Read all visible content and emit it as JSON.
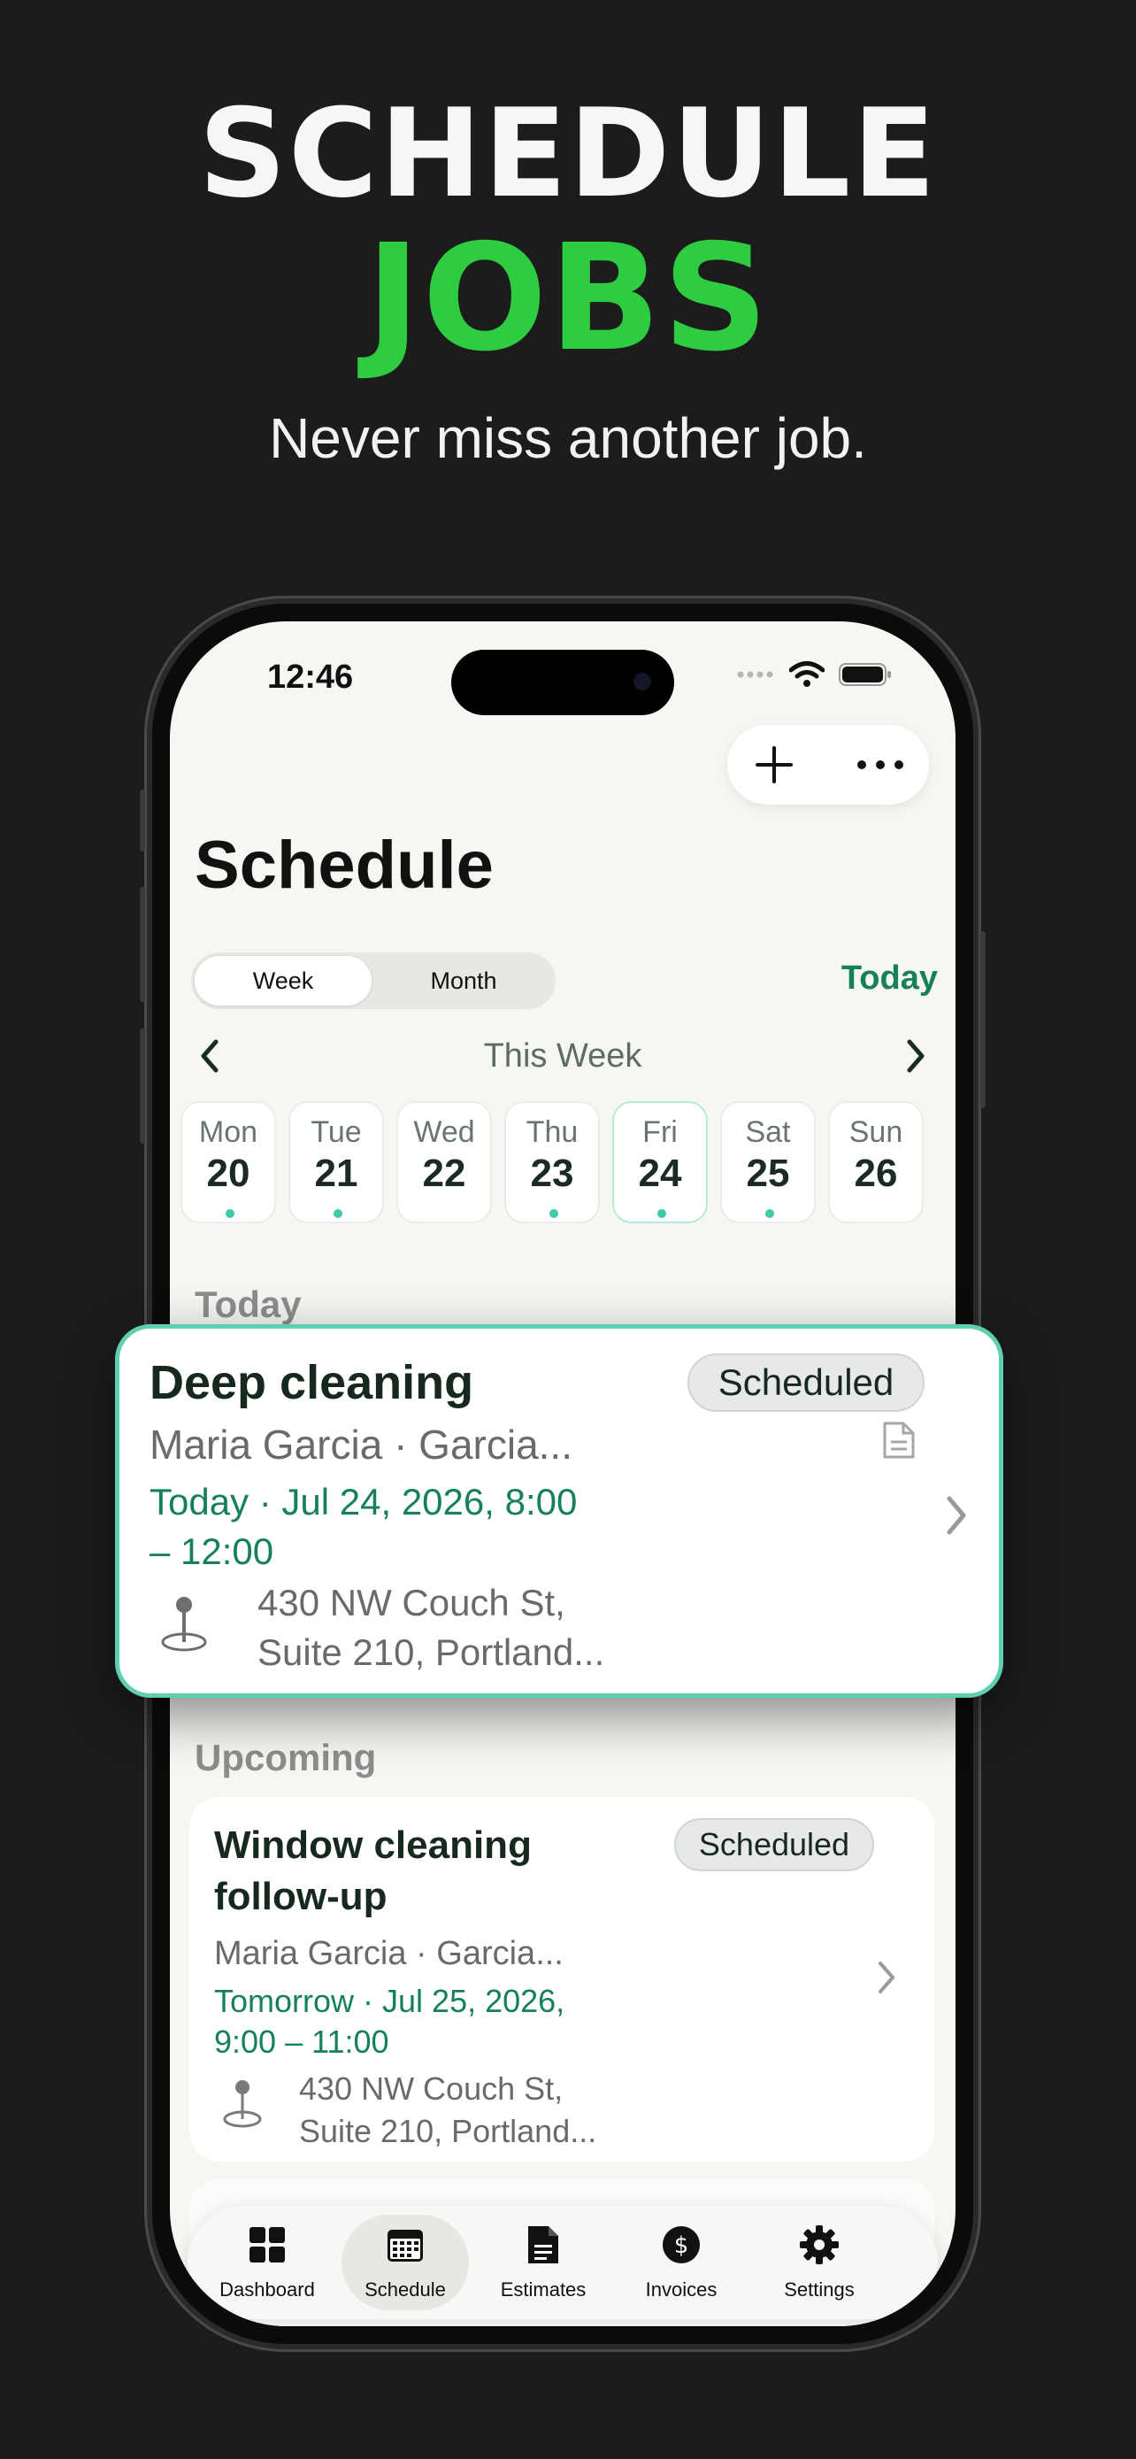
{
  "hero": {
    "title_line1": "SCHEDULE",
    "title_line2": "JOBS",
    "subtitle": "Never miss another job."
  },
  "status_bar": {
    "time": "12:46"
  },
  "header": {
    "title": "Schedule"
  },
  "view_toggle": {
    "week": "Week",
    "month": "Month",
    "selected": "Week"
  },
  "today_label": "Today",
  "week_nav": {
    "label": "This Week"
  },
  "days": [
    {
      "name": "Mon",
      "num": "20",
      "has_dot": true
    },
    {
      "name": "Tue",
      "num": "21",
      "has_dot": true
    },
    {
      "name": "Wed",
      "num": "22",
      "has_dot": false
    },
    {
      "name": "Thu",
      "num": "23",
      "has_dot": true
    },
    {
      "name": "Fri",
      "num": "24",
      "has_dot": true,
      "selected": true
    },
    {
      "name": "Sat",
      "num": "25",
      "has_dot": true
    },
    {
      "name": "Sun",
      "num": "26",
      "has_dot": false
    }
  ],
  "sections": {
    "today": "Today",
    "upcoming": "Upcoming"
  },
  "featured_job": {
    "title": "Deep cleaning",
    "status": "Scheduled",
    "client": "Maria Garcia · Garcia...",
    "time_line1": "Today · Jul 24, 2026, 8:00",
    "time_line2": "– 12:00",
    "address_line1": "430 NW Couch St,",
    "address_line2": "Suite 210, Portland..."
  },
  "upcoming_job": {
    "title_line1": "Window cleaning",
    "title_line2": "follow-up",
    "status": "Scheduled",
    "client": "Maria Garcia · Garcia...",
    "time_line1": "Tomorrow · Jul 25, 2026,",
    "time_line2": "9:00 – 11:00",
    "address_line1": "430 NW Couch St,",
    "address_line2": "Suite 210, Portland..."
  },
  "tabs": [
    {
      "label": "Dashboard",
      "icon": "grid-icon"
    },
    {
      "label": "Schedule",
      "icon": "calendar-icon",
      "active": true
    },
    {
      "label": "Estimates",
      "icon": "document-icon"
    },
    {
      "label": "Invoices",
      "icon": "dollar-icon"
    },
    {
      "label": "Settings",
      "icon": "gear-icon"
    }
  ],
  "colors": {
    "accent_green": "#16805a",
    "hero_green": "#2ecc40",
    "selection_teal": "#5ed0b0",
    "background": "#1c1c1c"
  }
}
